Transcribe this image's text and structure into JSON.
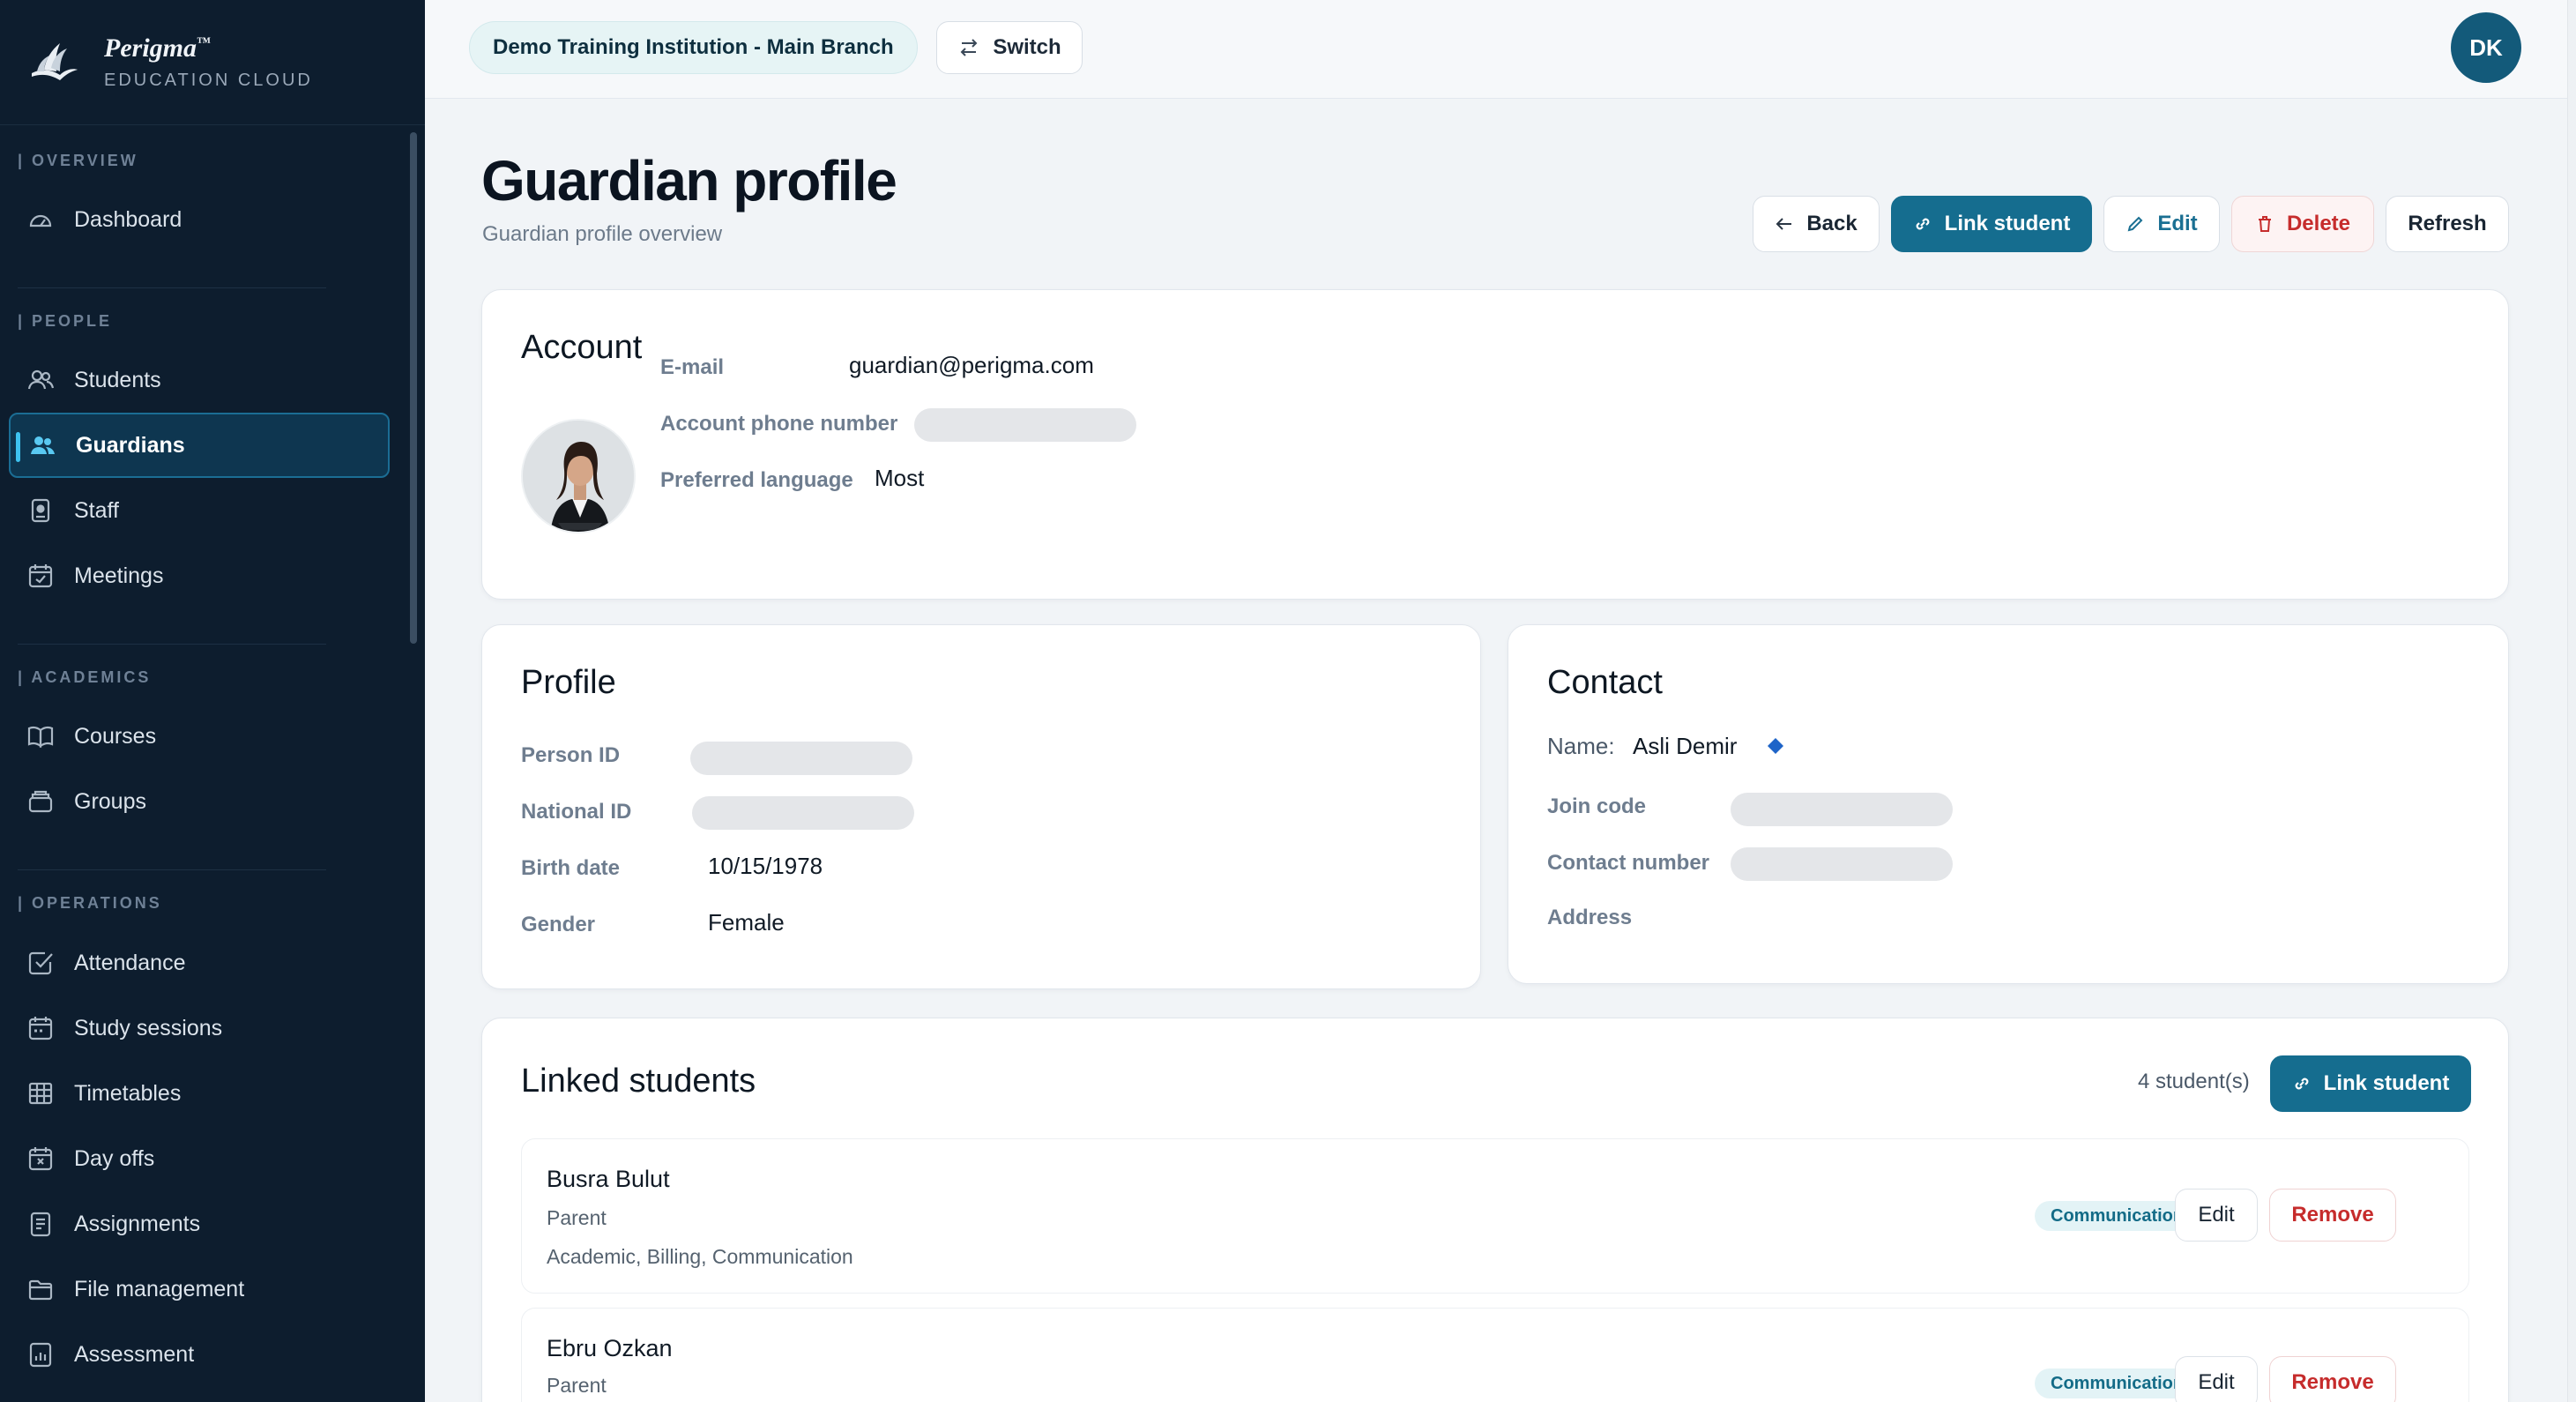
{
  "brand": {
    "name": "Perigma",
    "tm": "™",
    "sub": "EDUCATION CLOUD"
  },
  "sidebar": {
    "sections": [
      {
        "label": "| OVERVIEW"
      },
      {
        "label": "| PEOPLE"
      },
      {
        "label": "| ACADEMICS"
      },
      {
        "label": "| OPERATIONS"
      }
    ],
    "items": [
      {
        "label": "Dashboard",
        "icon": "gauge-icon"
      },
      {
        "label": "Students",
        "icon": "users-icon"
      },
      {
        "label": "Guardians",
        "icon": "guardians-icon"
      },
      {
        "label": "Staff",
        "icon": "badge-icon"
      },
      {
        "label": "Meetings",
        "icon": "calendar-check-icon"
      },
      {
        "label": "Courses",
        "icon": "book-icon"
      },
      {
        "label": "Groups",
        "icon": "layers-icon"
      },
      {
        "label": "Attendance",
        "icon": "checkbox-icon"
      },
      {
        "label": "Study sessions",
        "icon": "calendar-icon"
      },
      {
        "label": "Timetables",
        "icon": "grid-icon"
      },
      {
        "label": "Day offs",
        "icon": "calendar-x-icon"
      },
      {
        "label": "Assignments",
        "icon": "document-icon"
      },
      {
        "label": "File management",
        "icon": "folder-icon"
      },
      {
        "label": "Assessment",
        "icon": "chart-icon"
      }
    ],
    "active": "Guardians"
  },
  "topbar": {
    "branch": "Demo Training Institution - Main Branch",
    "switch_label": "Switch",
    "user_initials": "DK"
  },
  "page": {
    "title": "Guardian profile",
    "subtitle": "Guardian profile overview",
    "actions": {
      "back": "Back",
      "link_student": "Link student",
      "edit": "Edit",
      "delete": "Delete",
      "refresh": "Refresh"
    }
  },
  "account": {
    "title": "Account",
    "email_label": "E-mail",
    "email": "guardian@perigma.com",
    "phone_label": "Account phone number",
    "language_label": "Preferred language",
    "language": "Most"
  },
  "profile": {
    "title": "Profile",
    "person_id_label": "Person ID",
    "national_id_label": "National ID",
    "birth_label": "Birth date",
    "birth": "10/15/1978",
    "gender_label": "Gender",
    "gender": "Female"
  },
  "contact": {
    "title": "Contact",
    "name_label": "Name:",
    "name": "Asli Demir",
    "join_label": "Join code",
    "number_label": "Contact number",
    "address_label": "Address"
  },
  "linked": {
    "title": "Linked students",
    "count": "4 student(s)",
    "link_label": "Link student",
    "students": [
      {
        "name": "Busra Bulut",
        "relation": "Parent",
        "permissions": "Academic, Billing, Communication",
        "badge": "Communication",
        "edit": "Edit",
        "remove": "Remove"
      },
      {
        "name": "Ebru Ozkan",
        "relation": "Parent",
        "badge": "Communication",
        "edit": "Edit",
        "remove": "Remove"
      }
    ]
  },
  "colors": {
    "sidebar_bg": "#0d1d2e",
    "primary": "#156d8f",
    "danger": "#c62c2c",
    "accent": "#3ec2f0"
  }
}
